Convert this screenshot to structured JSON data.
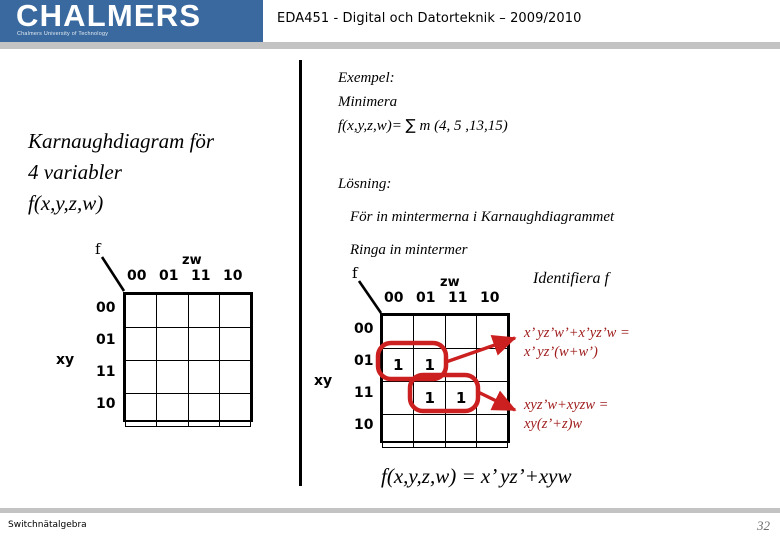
{
  "header": {
    "logo_word": "CHALMERS",
    "logo_sub": "Chalmers University of Technology",
    "title": "EDA451 - Digital och Datorteknik – 2009/2010",
    "logo_bg": "#39699e"
  },
  "left_panel": {
    "title_line1": "Karnaughdiagram för",
    "title_line2": "4 variabler",
    "title_line3": "f(x,y,z,w)",
    "kmap": {
      "f_label": "f",
      "col_group_label": "zw",
      "row_group_label": "xy",
      "col_headers": [
        "00",
        "01",
        "11",
        "10"
      ],
      "row_headers": [
        "00",
        "01",
        "11",
        "10"
      ],
      "cells": [
        [
          "",
          "",
          "",
          ""
        ],
        [
          "",
          "",
          "",
          ""
        ],
        [
          "",
          "",
          "",
          ""
        ],
        [
          "",
          "",
          "",
          ""
        ]
      ]
    }
  },
  "right_panel": {
    "example_heading": "Exempel:",
    "example_line2": "Minimera",
    "example_expr_prefix": "f(x,y,z,w)= ",
    "example_expr_sum": "∑",
    "example_expr_suffix": " m (4, 5 ,13,15)",
    "solution_heading": "Lösning:",
    "solution_step1": "För in mintermerna i Karnaughdiagrammet",
    "solution_step2": "Ringa in mintermer",
    "identify_label": "Identifiera  f",
    "kmap": {
      "f_label": "f",
      "col_group_label": "zw",
      "row_group_label": "xy",
      "col_headers": [
        "00",
        "01",
        "11",
        "10"
      ],
      "row_headers": [
        "00",
        "01",
        "11",
        "10"
      ],
      "cells": [
        [
          "",
          "",
          "",
          ""
        ],
        [
          "1",
          "1",
          "",
          ""
        ],
        [
          "",
          "1",
          "1",
          ""
        ],
        [
          "",
          "",
          "",
          ""
        ]
      ]
    },
    "annotation_1_line1": "x’ yz’w’+x’yz’w =",
    "annotation_1_line2": "x’ yz’(w+w’)",
    "annotation_2_line1": "xyz’w+xyzw =",
    "annotation_2_line2": "xy(z’+z)w",
    "result_expr": "f(x,y,z,w)  = x’ yz’+xyw",
    "accent_color": "#9e1b1b",
    "ring_color": "#cc2020"
  },
  "footer": {
    "left": "Switchnätalgebra",
    "right": "32"
  }
}
